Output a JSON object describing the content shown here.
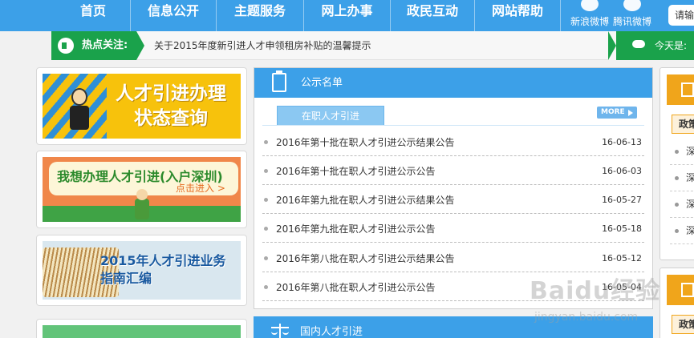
{
  "nav": {
    "items": [
      "首页",
      "信息公开",
      "主题服务",
      "网上办事",
      "政民互动",
      "网站帮助"
    ],
    "social": [
      {
        "label": "新浪微博",
        "icon": "sina-weibo-icon"
      },
      {
        "label": "腾讯微博",
        "icon": "tencent-weibo-icon"
      }
    ],
    "search_text": "请输"
  },
  "ticker": {
    "hot_label": "热点关注:",
    "text": "关于2015年度新引进人才申领租房补贴的温馨提示",
    "weather_label": "今天是:"
  },
  "banners": [
    {
      "title_line1": "人才引进办理",
      "title_line2": "状态查询"
    },
    {
      "title": "我想办理人才引进(入户深圳)",
      "link": "点击进入 >"
    },
    {
      "title_line1": "2015年人才引进业务",
      "title_line2": "指南汇编"
    }
  ],
  "announcements": {
    "title": "公示名单",
    "tab": "在职人才引进",
    "more": "MORE",
    "items": [
      {
        "text": "2016年第十批在职人才引进公示结果公告",
        "date": "16-06-13"
      },
      {
        "text": "2016年第十批在职人才引进公示公告",
        "date": "16-06-03"
      },
      {
        "text": "2016年第九批在职人才引进公示结果公告",
        "date": "16-05-27"
      },
      {
        "text": "2016年第九批在职人才引进公示公告",
        "date": "16-05-18"
      },
      {
        "text": "2016年第八批在职人才引进公示结果公告",
        "date": "16-05-12"
      },
      {
        "text": "2016年第八批在职人才引进公示公告",
        "date": "16-05-04"
      }
    ]
  },
  "domestic": {
    "title": "国内人才引进"
  },
  "right": {
    "tab1": "政策",
    "items": [
      "深",
      "深",
      "深",
      "深"
    ],
    "tab2": "政策"
  },
  "watermark": {
    "main": "Baidu经验",
    "sub": "jingyan.baidu.com"
  },
  "colors": {
    "nav_blue": "#3ca0e8",
    "hot_green": "#1aa24b",
    "accent_orange": "#f0a51b"
  }
}
